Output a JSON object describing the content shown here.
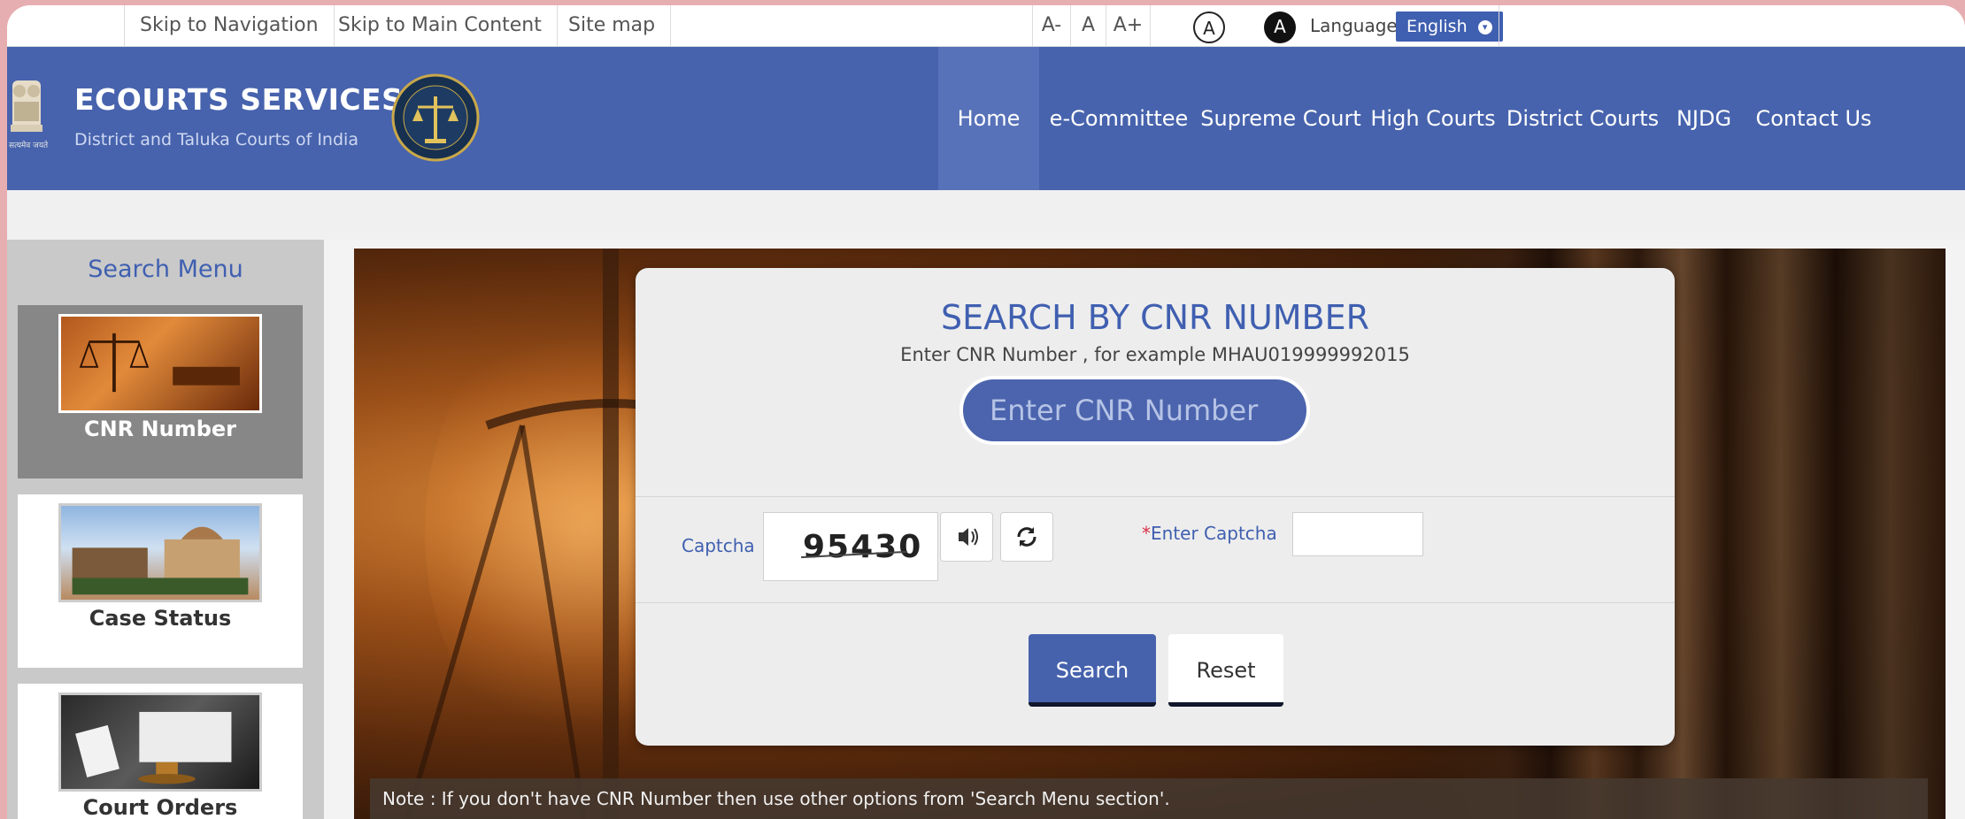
{
  "topbar": {
    "skip_navigation": "Skip to Navigation",
    "skip_main": "Skip to Main Content",
    "site_map": "Site map",
    "font_decrease": "A-",
    "font_normal": "A",
    "font_increase": "A+",
    "contrast_normal": "A",
    "contrast_high": "A",
    "language_label": "Language",
    "language_value": "English"
  },
  "header": {
    "title": "ECOURTS SERVICES",
    "subtitle": "District and Taluka Courts of India",
    "emblem_text": "सत्यमेव जयते",
    "nav": [
      "Home",
      "e-Committee",
      "Supreme Court",
      "High Courts",
      "District Courts",
      "NJDG",
      "Contact Us"
    ]
  },
  "sidebar": {
    "title": "Search Menu",
    "items": [
      "CNR Number",
      "Case Status",
      "Court Orders"
    ]
  },
  "panel": {
    "title": "SEARCH BY CNR NUMBER",
    "subtitle": "Enter CNR Number , for example MHAU019999992015",
    "cnr_placeholder": "Enter CNR Number",
    "captcha_label": "Captcha",
    "captcha_value": "95430",
    "enter_captcha_star": "*",
    "enter_captcha_label": "Enter Captcha",
    "search_button": "Search",
    "reset_button": "Reset"
  },
  "note": "Note : If you don't have CNR Number then use other options from 'Search Menu section'.",
  "colors": {
    "primary": "#4763ad",
    "page_border": "#e7aeb1",
    "required": "#d9304a"
  },
  "icons": [
    "national-emblem-icon",
    "ecourts-logo-icon",
    "speaker-icon",
    "refresh-icon",
    "chevron-down-icon"
  ]
}
